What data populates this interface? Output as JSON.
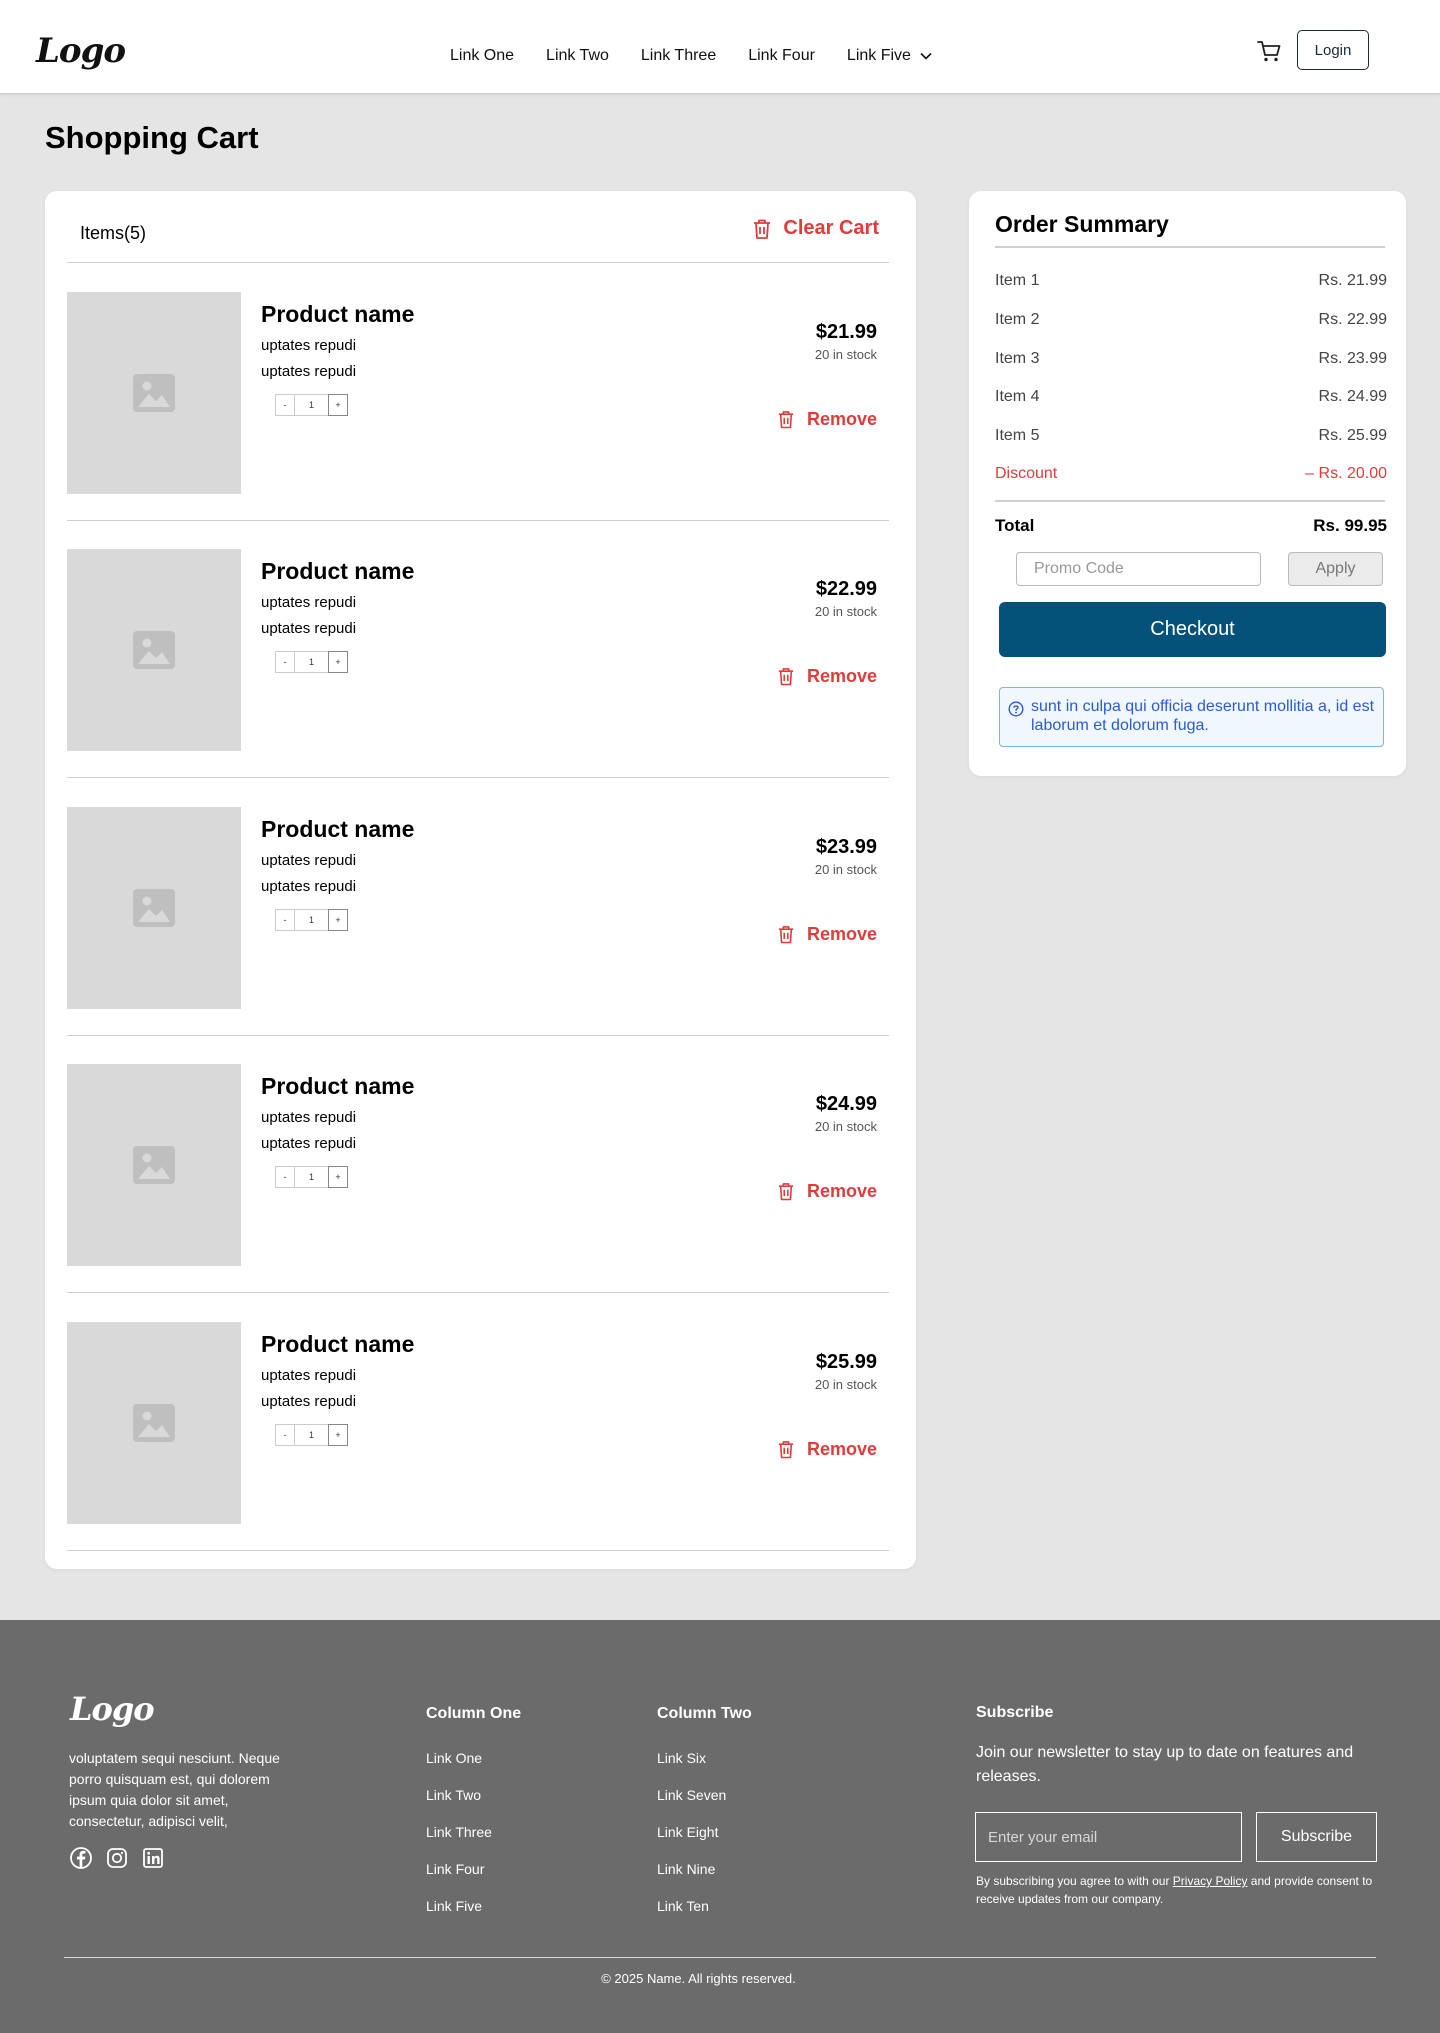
{
  "header": {
    "logo": "Logo",
    "nav": [
      "Link One",
      "Link Two",
      "Link Three",
      "Link Four",
      "Link Five"
    ],
    "login_label": "Login"
  },
  "page": {
    "title": "Shopping Cart"
  },
  "cart": {
    "items_label": "Items(5)",
    "clear_label": "Clear Cart",
    "remove_label": "Remove",
    "items": [
      {
        "name": "Product name",
        "desc1": "uptates repudi",
        "desc2": "uptates repudi",
        "qty": "1",
        "minus": "-",
        "plus": "+",
        "price": "$21.99",
        "stock": "20 in stock"
      },
      {
        "name": "Product name",
        "desc1": "uptates repudi",
        "desc2": "uptates repudi",
        "qty": "1",
        "minus": "-",
        "plus": "+",
        "price": "$22.99",
        "stock": "20 in stock"
      },
      {
        "name": "Product name",
        "desc1": "uptates repudi",
        "desc2": "uptates repudi",
        "qty": "1",
        "minus": "-",
        "plus": "+",
        "price": "$23.99",
        "stock": "20 in stock"
      },
      {
        "name": "Product name",
        "desc1": "uptates repudi",
        "desc2": "uptates repudi",
        "qty": "1",
        "minus": "-",
        "plus": "+",
        "price": "$24.99",
        "stock": "20 in stock"
      },
      {
        "name": "Product name",
        "desc1": "uptates repudi",
        "desc2": "uptates repudi",
        "qty": "1",
        "minus": "-",
        "plus": "+",
        "price": "$25.99",
        "stock": "20 in stock"
      }
    ]
  },
  "summary": {
    "title": "Order Summary",
    "rows": [
      {
        "label": "Item 1",
        "value": "Rs. 21.99"
      },
      {
        "label": "Item 2",
        "value": "Rs. 22.99"
      },
      {
        "label": "Item 3",
        "value": "Rs. 23.99"
      },
      {
        "label": "Item 4",
        "value": "Rs. 24.99"
      },
      {
        "label": "Item 5",
        "value": "Rs. 25.99"
      }
    ],
    "discount_label": "Discount",
    "discount_value": "– Rs. 20.00",
    "total_label": "Total",
    "total_value": "Rs. 99.95",
    "promo_placeholder": "Promo Code",
    "apply_label": "Apply",
    "checkout_label": "Checkout",
    "info_text": "sunt in culpa qui officia deserunt mollitia a, id est laborum et dolorum fuga."
  },
  "footer": {
    "logo": "Logo",
    "description": "voluptatem sequi nesciunt. Neque porro quisquam est, qui dolorem ipsum quia dolor sit amet, consectetur, adipisci velit,",
    "socials": [
      "facebook-icon",
      "instagram-icon",
      "linkedin-icon"
    ],
    "col1": {
      "title": "Column One",
      "links": [
        "Link One",
        "Link Two",
        "Link Three",
        "Link Four",
        "Link Five"
      ]
    },
    "col2": {
      "title": "Column Two",
      "links": [
        "Link Six",
        "Link Seven",
        "Link Eight",
        "Link Nine",
        "Link Ten"
      ]
    },
    "subscribe": {
      "title": "Subscribe",
      "text": "Join our newsletter to stay up to date on features and releases.",
      "email_placeholder": "Enter your email",
      "button_label": "Subscribe",
      "legal_prefix": "By subscribing you agree to with our ",
      "legal_link": "Privacy Policy",
      "legal_suffix": " and provide consent to receive updates from our company."
    },
    "copyright": "© 2025 Name. All rights reserved."
  },
  "colors": {
    "accent_red": "#e23b3b",
    "checkout_blue": "#04527a",
    "info_blue": "#2a5bd7",
    "footer_bg": "#6b6b6b",
    "page_bg": "#e5e5e5"
  }
}
